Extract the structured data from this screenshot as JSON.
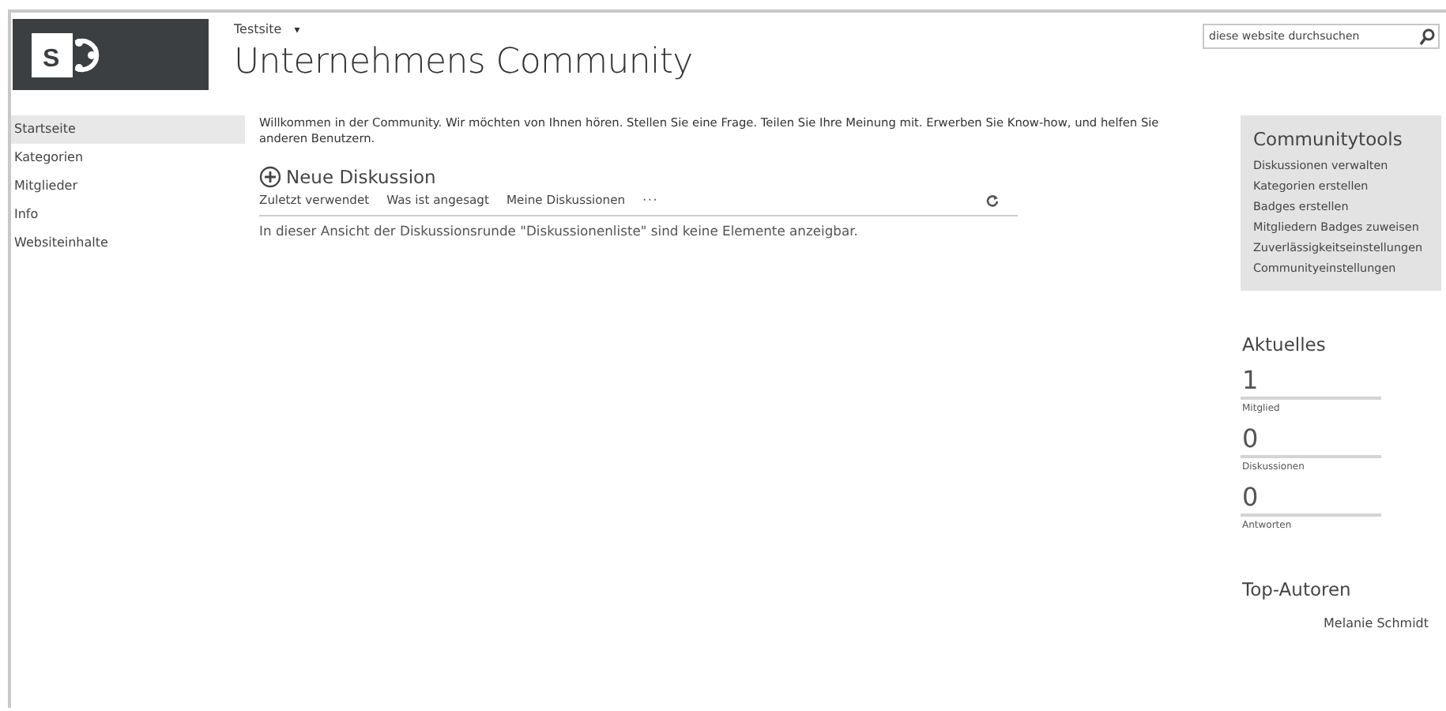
{
  "header": {
    "logo_letter": "S",
    "breadcrumb": "Testsite",
    "breadcrumb_caret": "▾",
    "title": "Unternehmens Community",
    "search": {
      "placeholder": "diese website durchsuchen"
    }
  },
  "nav": {
    "items": [
      {
        "label": "Startseite",
        "selected": true
      },
      {
        "label": "Kategorien",
        "selected": false
      },
      {
        "label": "Mitglieder",
        "selected": false
      },
      {
        "label": "Info",
        "selected": false
      },
      {
        "label": "Websiteinhalte",
        "selected": false
      }
    ]
  },
  "main": {
    "welcome": "Willkommen in der Community. Wir möchten von Ihnen hören. Stellen Sie eine Frage. Teilen Sie Ihre Meinung mit. Erwerben Sie Know-how, und helfen Sie anderen Benutzern.",
    "new_discussion": "Neue Diskussion",
    "views": [
      {
        "label": "Zuletzt verwendet",
        "selected": false
      },
      {
        "label": "Was ist angesagt",
        "selected": false
      },
      {
        "label": "Meine Diskussionen",
        "selected": false
      }
    ],
    "more": "···",
    "empty_message": "In dieser Ansicht der Diskussionsrunde \"Diskussionenliste\" sind keine Elemente anzeigbar."
  },
  "community_tools": {
    "title": "Communitytools",
    "links": [
      "Diskussionen verwalten",
      "Kategorien erstellen",
      "Badges erstellen",
      "Mitgliedern Badges zuweisen",
      "Zuverlässigkeitseinstellungen",
      "Communityeinstellungen"
    ]
  },
  "news": {
    "title": "Aktuelles",
    "stats": [
      {
        "value": "1",
        "label": "Mitglied"
      },
      {
        "value": "0",
        "label": "Diskussionen"
      },
      {
        "value": "0",
        "label": "Antworten"
      }
    ]
  },
  "top_authors": {
    "title": "Top-Autoren",
    "authors": [
      "Melanie Schmidt"
    ]
  }
}
